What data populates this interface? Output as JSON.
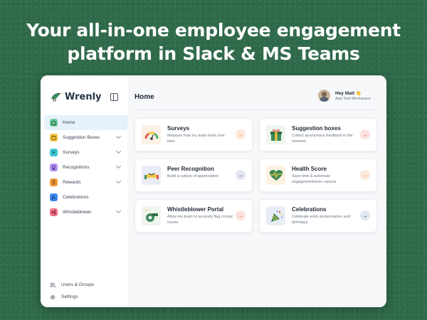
{
  "headline": {
    "line1": "Your all-in-one employee engagement",
    "line2": "platform in Slack & MS Teams"
  },
  "app": {
    "logo_text": "Wrenly",
    "brand_color": "#2f6a4a"
  },
  "sidebar": {
    "items": [
      {
        "label": "Home",
        "icon": "home-icon",
        "active": true
      },
      {
        "label": "Suggestion Boxes",
        "icon": "box-icon"
      },
      {
        "label": "Surveys",
        "icon": "survey-icon"
      },
      {
        "label": "Recognitions",
        "icon": "award-icon"
      },
      {
        "label": "Rewards",
        "icon": "trophy-icon"
      },
      {
        "label": "Celebrations",
        "icon": "celebration-icon"
      },
      {
        "label": "Whistleblower",
        "icon": "megaphone-icon"
      }
    ],
    "bottom": [
      {
        "label": "Users & Groups",
        "icon": "users-icon"
      },
      {
        "label": "Settings",
        "icon": "gear-icon"
      }
    ]
  },
  "header": {
    "title": "Home",
    "greeting": "Hey Matt 👋",
    "workspace": "App Test Workspace"
  },
  "cards": [
    {
      "title": "Surveys",
      "desc": "Measure how my team feels over time",
      "icon": "gauge-icon",
      "accent": "#f28a3c"
    },
    {
      "title": "Suggestion boxes",
      "desc": "Collect anonymous feedback in the moment",
      "icon": "gift-box-icon",
      "accent": "#e3584e"
    },
    {
      "title": "Peer Recognition",
      "desc": "Build a culture of appreciation",
      "icon": "handshake-icon",
      "accent": "#34466b"
    },
    {
      "title": "Health Score",
      "desc": "Save time & automate engagement/exec reports",
      "icon": "heartbeat-icon",
      "accent": "#f28a3c"
    },
    {
      "title": "Whistleblower Portal",
      "desc": "Allow my team to securely flag crucial issues",
      "icon": "whistle-icon",
      "accent": "#e3584e"
    },
    {
      "title": "Celebrations",
      "desc": "Celebrate work anniversaries and birthdays",
      "icon": "party-popper-icon",
      "accent": "#34466b"
    }
  ]
}
